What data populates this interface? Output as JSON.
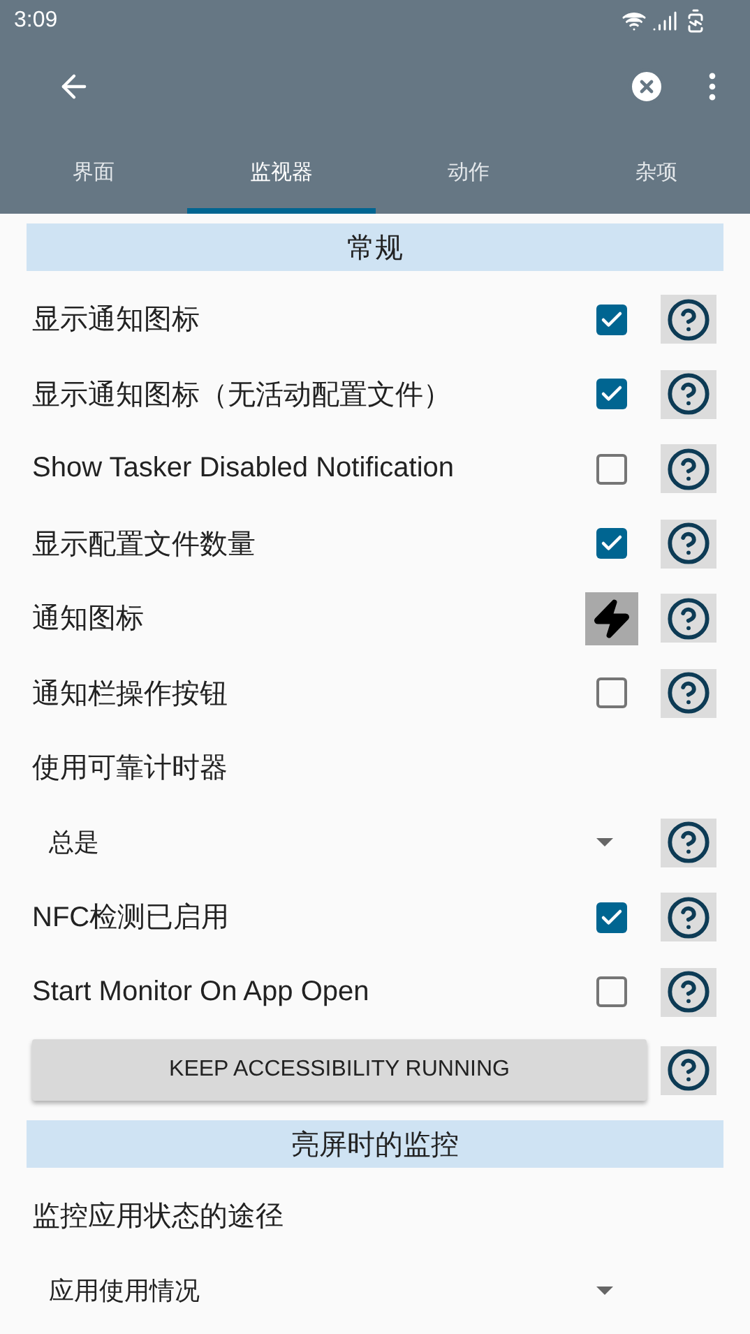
{
  "status_bar": {
    "time": "3:09"
  },
  "tabs": [
    {
      "label": "界面",
      "selected": false
    },
    {
      "label": "监视器",
      "selected": true
    },
    {
      "label": "动作",
      "selected": false
    },
    {
      "label": "杂项",
      "selected": false
    }
  ],
  "items": [
    {
      "kind": "section",
      "label": "常规"
    },
    {
      "kind": "checkbox",
      "label": "显示通知图标",
      "checked": true,
      "help": true
    },
    {
      "kind": "checkbox",
      "label": "显示通知图标（无活动配置文件）",
      "checked": true,
      "help": true
    },
    {
      "kind": "checkbox",
      "label": "Show Tasker Disabled Notification",
      "checked": false,
      "help": true
    },
    {
      "kind": "checkbox",
      "label": "显示配置文件数量",
      "checked": true,
      "help": true
    },
    {
      "kind": "icon",
      "label": "通知图标",
      "help": true
    },
    {
      "kind": "checkbox",
      "label": "通知栏操作按钮",
      "checked": false,
      "help": true
    },
    {
      "kind": "label",
      "label": "使用可靠计时器"
    },
    {
      "kind": "dropdown",
      "label": "总是",
      "help": true
    },
    {
      "kind": "checkbox",
      "label": "NFC检测已启用",
      "checked": true,
      "help": true
    },
    {
      "kind": "checkbox",
      "label": "Start Monitor On App Open",
      "checked": false,
      "help": true
    },
    {
      "kind": "button",
      "label": "KEEP ACCESSIBILITY RUNNING",
      "help": true
    },
    {
      "kind": "section",
      "label": "亮屏时的监控"
    },
    {
      "kind": "label",
      "label": "监控应用状态的途径"
    },
    {
      "kind": "dropdown",
      "label": "应用使用情况"
    }
  ]
}
